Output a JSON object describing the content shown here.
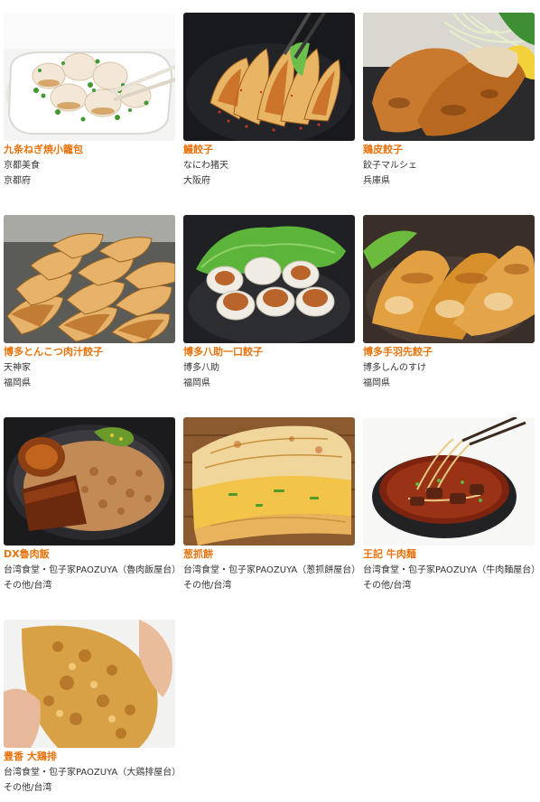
{
  "accent_color": "#e8730c",
  "text_color": "#333333",
  "items": [
    {
      "name": "九条ねぎ焼小籠包",
      "shop": "京都美食",
      "pref": "京都府",
      "image": "xiaolongbao-with-green-onion-photo"
    },
    {
      "name": "鰻餃子",
      "shop": "なにわ猪天",
      "pref": "大阪府",
      "image": "eel-gyoza-photo"
    },
    {
      "name": "鶏皮餃子",
      "shop": "餃子マルシェ",
      "pref": "兵庫県",
      "image": "chicken-skin-gyoza-photo"
    },
    {
      "name": "博多とんこつ肉汁餃子",
      "shop": "天神家",
      "pref": "福岡県",
      "image": "pan-fried-gyoza-photo"
    },
    {
      "name": "博多八助一口餃子",
      "shop": "博多八助",
      "pref": "福岡県",
      "image": "bite-size-gyoza-photo"
    },
    {
      "name": "博多手羽先餃子",
      "shop": "博多しんのすけ",
      "pref": "福岡県",
      "image": "chicken-wing-gyoza-photo"
    },
    {
      "name": "DX魯肉飯",
      "shop": "台湾食堂・包子家PAOZUYA（魯肉飯屋台）",
      "pref": "その他/台湾",
      "image": "braised-pork-rice-photo"
    },
    {
      "name": "葱抓餅",
      "shop": "台湾食堂・包子家PAOZUYA（葱抓餅屋台）",
      "pref": "その他/台湾",
      "image": "scallion-pancake-photo"
    },
    {
      "name": "王記 牛肉麺",
      "shop": "台湾食堂・包子家PAOZUYA（牛肉麺屋台）",
      "pref": "その他/台湾",
      "image": "beef-noodle-soup-photo"
    },
    {
      "name": "豊香 大鶏排",
      "shop": "台湾食堂・包子家PAOZUYA（大鶏排屋台）",
      "pref": "その他/台湾",
      "image": "fried-chicken-cutlet-photo"
    }
  ]
}
